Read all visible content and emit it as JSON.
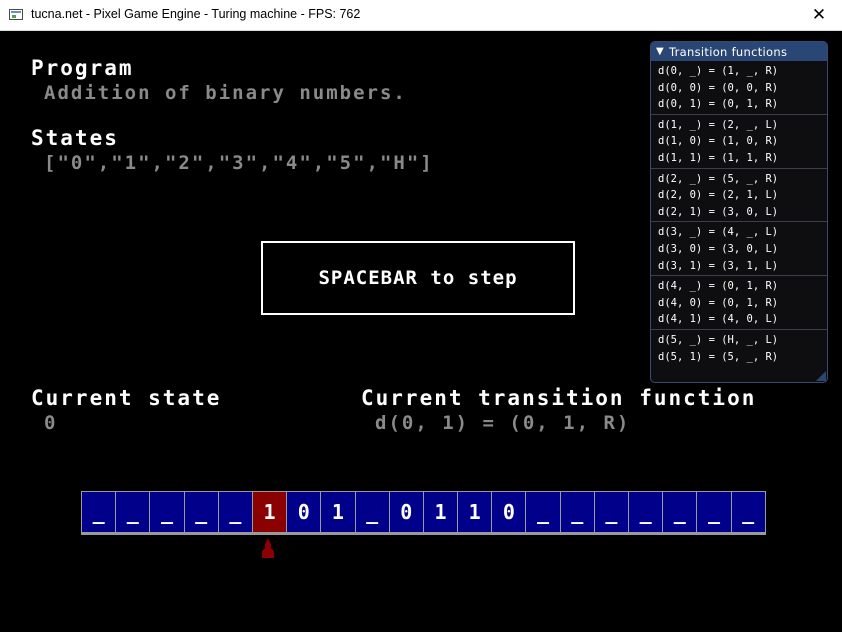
{
  "window": {
    "title": "tucna.net - Pixel Game Engine - Turing machine - FPS: 762",
    "close_glyph": "✕"
  },
  "program": {
    "heading": "Program",
    "value": "Addition of binary numbers."
  },
  "states": {
    "heading": "States",
    "value": "[\"0\",\"1\",\"2\",\"3\",\"4\",\"5\",\"H\"]"
  },
  "step_prompt": "SPACEBAR to step",
  "current_state": {
    "heading": "Current state",
    "value": "0"
  },
  "current_transition": {
    "heading": "Current transition function",
    "value": "d(0, 1) = (0, 1, R)"
  },
  "tape": {
    "cells": [
      "_",
      "_",
      "_",
      "_",
      "_",
      "1",
      "0",
      "1",
      "_",
      "0",
      "1",
      "1",
      "0",
      "_",
      "_",
      "_",
      "_",
      "_",
      "_",
      "_"
    ],
    "head_index": 5
  },
  "panel": {
    "title": "Transition functions",
    "collapse_glyph": "▼",
    "groups": [
      [
        "d(0, _) = (1, _, R)",
        "d(0, 0) = (0, 0, R)",
        "d(0, 1) = (0, 1, R)"
      ],
      [
        "d(1, _) = (2, _, L)",
        "d(1, 0) = (1, 0, R)",
        "d(1, 1) = (1, 1, R)"
      ],
      [
        "d(2, _) = (5, _, R)",
        "d(2, 0) = (2, 1, L)",
        "d(2, 1) = (3, 0, L)"
      ],
      [
        "d(3, _) = (4, _, L)",
        "d(3, 0) = (3, 0, L)",
        "d(3, 1) = (3, 1, L)"
      ],
      [
        "d(4, _) = (0, 1, R)",
        "d(4, 0) = (0, 1, R)",
        "d(4, 1) = (4, 0, L)"
      ],
      [
        "d(5, _) = (H, _, L)",
        "d(5, 1) = (5, _, R)"
      ]
    ]
  },
  "colors": {
    "tape_cell": "#00008b",
    "tape_head_cell": "#8b0000",
    "head_marker": "#8b0000",
    "panel_header": "#2a4674",
    "heading_text": "#ffffff",
    "value_text": "#8a8a8a"
  }
}
